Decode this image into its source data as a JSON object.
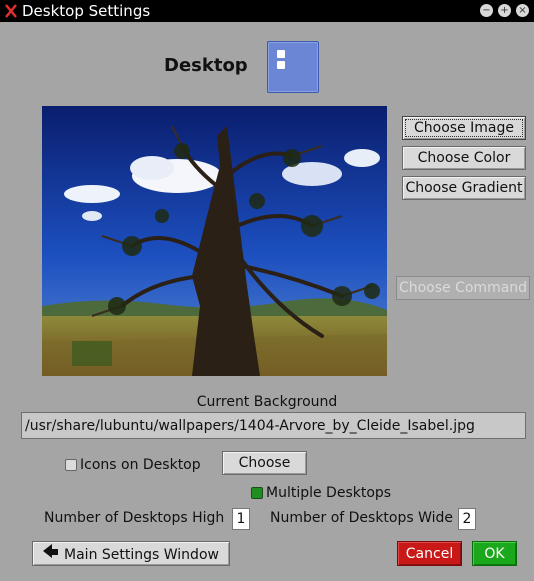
{
  "window": {
    "title": "Desktop Settings"
  },
  "header": {
    "title": "Desktop"
  },
  "buttons": {
    "choose_image": "Choose Image",
    "choose_color": "Choose Color",
    "choose_gradient": "Choose Gradient",
    "choose_command": "Choose Command",
    "choose_icons": "Choose",
    "main_settings": "Main Settings Window",
    "cancel": "Cancel",
    "ok": "OK"
  },
  "background": {
    "label": "Current Background",
    "path": "/usr/share/lubuntu/wallpapers/1404-Arvore_by_Cleide_Isabel.jpg"
  },
  "options": {
    "icons_on_desktop": "Icons on Desktop",
    "icons_on_desktop_checked": false,
    "multiple_desktops": "Multiple Desktops",
    "multiple_desktops_enabled": true,
    "desktops_high_label": "Number of Desktops High",
    "desktops_high": "1",
    "desktops_wide_label": "Number of Desktops Wide",
    "desktops_wide": "2"
  },
  "colors": {
    "ok": "#1ca81c",
    "cancel": "#c81818",
    "panel": "#a5a5a5",
    "titlebar": "#000000"
  }
}
